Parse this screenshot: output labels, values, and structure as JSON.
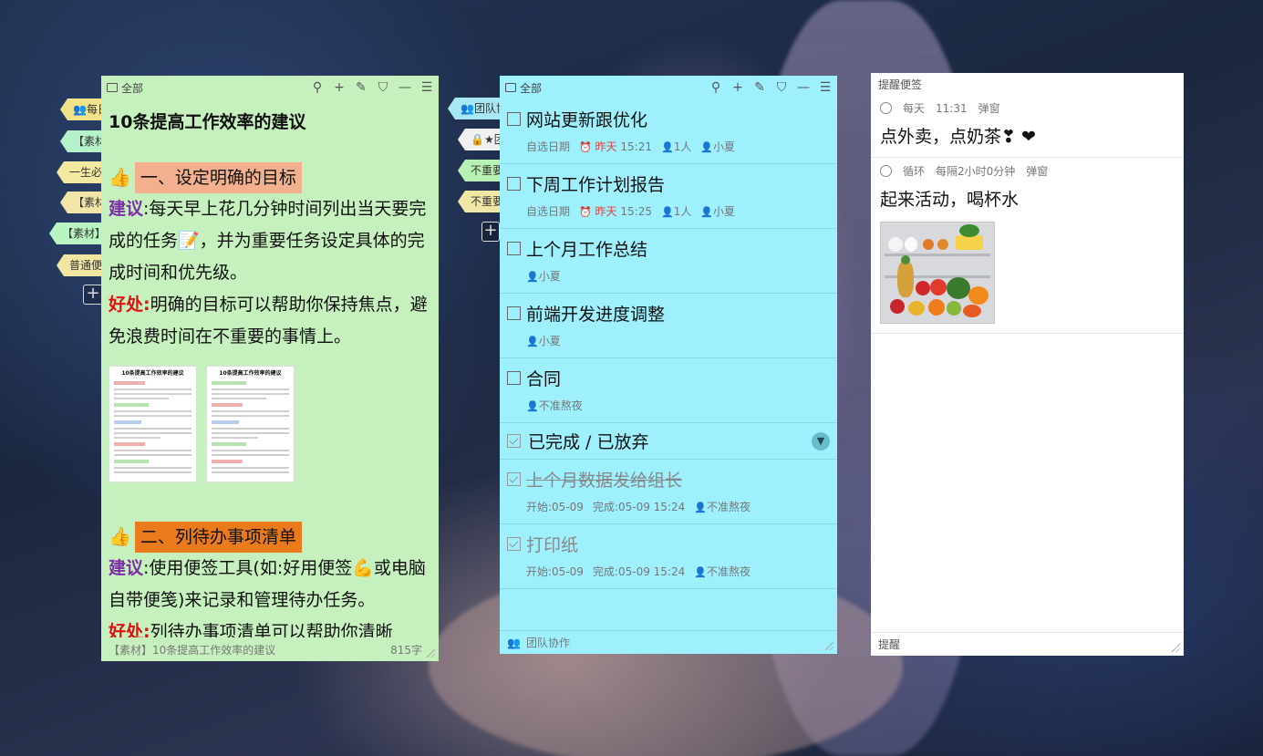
{
  "colors": {
    "note1_bg": "#c6f0be",
    "note2_bg": "#9ef0fd",
    "note3_bg": "#ffffff",
    "section1_highlight": "#f3b08f",
    "section2_highlight": "#ea7b1c",
    "advice_label": "#7b2fa6",
    "benefit_label": "#e01010"
  },
  "left_tags": [
    {
      "label": "👥每日"
    },
    {
      "label": "【素材"
    },
    {
      "label": "一生必"
    },
    {
      "label": "【素材"
    },
    {
      "label": "【素材】"
    },
    {
      "label": "普通便"
    }
  ],
  "mid_tags": [
    {
      "label": "👥团队协"
    },
    {
      "label": "🔒★团"
    },
    {
      "label": "不重要"
    },
    {
      "label": "不重要"
    }
  ],
  "note1": {
    "folder": "全部",
    "title": "10条提高工作效率的建议",
    "sec1_title": "一、设定明确的目标",
    "sec1_adv_label": "建议",
    "sec1_adv_text": ":每天早上花几分钟时间列出当天要完成的任务📝，并为重要任务设定具体的完成时间和优先级。",
    "sec1_ben_label": "好处:",
    "sec1_ben_text": "明确的目标可以帮助你保持焦点，避免浪费时间在不重要的事情上。",
    "img_title_1": "10条提高工作效率的建议",
    "img_title_2": "10条提高工作效率的建议",
    "sec2_title": "二、列待办事项清单",
    "sec2_adv_label": "建议",
    "sec2_adv_text": ":使用便签工具(如:好用便签💪或电脑自带便笺)来记录和管理待办任务。",
    "sec2_ben_label": "好处:",
    "sec2_ben_text": "列待办事项清单可以帮助你清晰",
    "footer_left": "【素材】10条提高工作效率的建议",
    "footer_right": "815字"
  },
  "note2": {
    "folder": "全部",
    "todos": [
      {
        "title": "网站更新跟优化",
        "date_label": "自选日期",
        "day": "昨天",
        "time": "15:21",
        "count": "1人",
        "assignee": "小夏"
      },
      {
        "title": "下周工作计划报告",
        "date_label": "自选日期",
        "day": "昨天",
        "time": "15:25",
        "count": "1人",
        "assignee": "小夏"
      },
      {
        "title": "上个月工作总结",
        "assignee": "小夏"
      },
      {
        "title": "前端开发进度调整",
        "assignee": "小夏"
      },
      {
        "title": "合同",
        "assignee": "不准熬夜"
      }
    ],
    "done_header": "已完成 / 已放弃",
    "done": [
      {
        "title": "上个月数据发给组长",
        "start": "开始:05-09",
        "finish": "完成:05-09 15:24",
        "assignee": "不准熬夜"
      },
      {
        "title": "打印纸",
        "start": "开始:05-09",
        "finish": "完成:05-09 15:24",
        "assignee": "不准熬夜"
      }
    ],
    "footer": "团队协作"
  },
  "note3": {
    "title": "提醒便签",
    "reminders": [
      {
        "repeat": "每天",
        "time": "11:31",
        "mode": "弹窗",
        "body": "点外卖，点奶茶❣ ❤"
      },
      {
        "repeat": "循环",
        "time": "每隔2小时0分钟",
        "mode": "弹窗",
        "body": "起来活动，喝杯水"
      }
    ],
    "footer": "提醒"
  }
}
